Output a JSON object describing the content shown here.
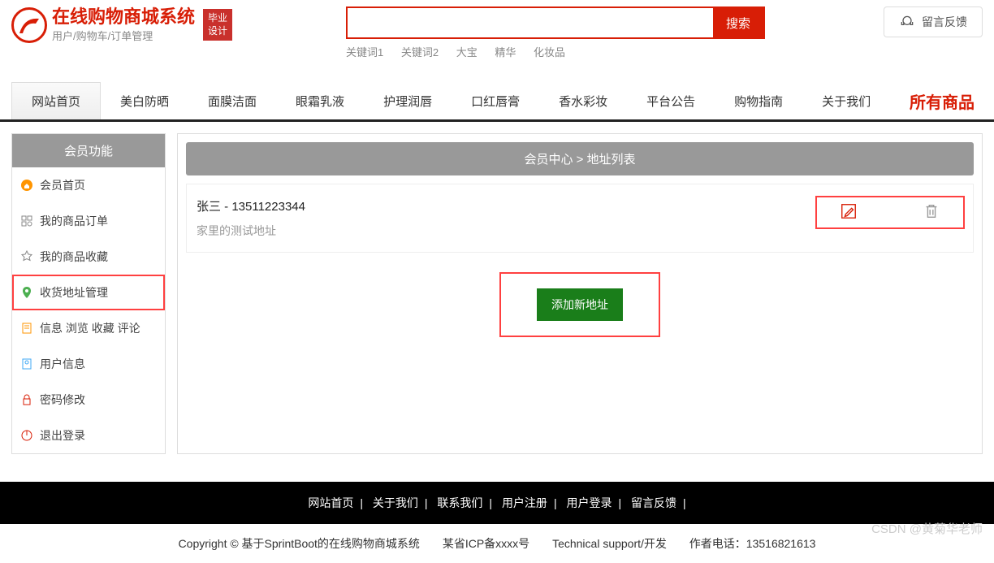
{
  "header": {
    "site_title": "在线购物商城系统",
    "site_sub": "用户/购物车/订单管理",
    "badge": "毕业设计",
    "search_btn": "搜索",
    "keywords": [
      "关键词1",
      "关键词2",
      "大宝",
      "精华",
      "化妆品"
    ],
    "feedback": "留言反馈"
  },
  "nav": {
    "items": [
      "网站首页",
      "美白防晒",
      "面膜洁面",
      "眼霜乳液",
      "护理润唇",
      "口红唇膏",
      "香水彩妆",
      "平台公告",
      "购物指南",
      "关于我们"
    ],
    "all_products": "所有商品"
  },
  "sidebar": {
    "title": "会员功能",
    "items": [
      {
        "label": "会员首页",
        "icon": "home"
      },
      {
        "label": "我的商品订单",
        "icon": "grid"
      },
      {
        "label": "我的商品收藏",
        "icon": "star"
      },
      {
        "label": "收货地址管理",
        "icon": "location",
        "active": true
      },
      {
        "label": "信息 浏览 收藏 评论",
        "icon": "doc"
      },
      {
        "label": "用户信息",
        "icon": "user"
      },
      {
        "label": "密码修改",
        "icon": "lock"
      },
      {
        "label": "退出登录",
        "icon": "power"
      }
    ]
  },
  "content": {
    "breadcrumb": "会员中心 > 地址列表",
    "address": {
      "name_phone": "张三 - 13511223344",
      "detail": "家里的测试地址"
    },
    "add_button": "添加新地址"
  },
  "footer": {
    "links": [
      "网站首页",
      "关于我们",
      "联系我们",
      "用户注册",
      "用户登录",
      "留言反馈"
    ],
    "copyright": "Copyright © 基于SprintBoot的在线购物商城系统",
    "icp": "某省ICP备xxxx号",
    "support": "Technical support/开发",
    "author": "作者电话：13516821613"
  },
  "watermark": "CSDN @黄菊华老师"
}
